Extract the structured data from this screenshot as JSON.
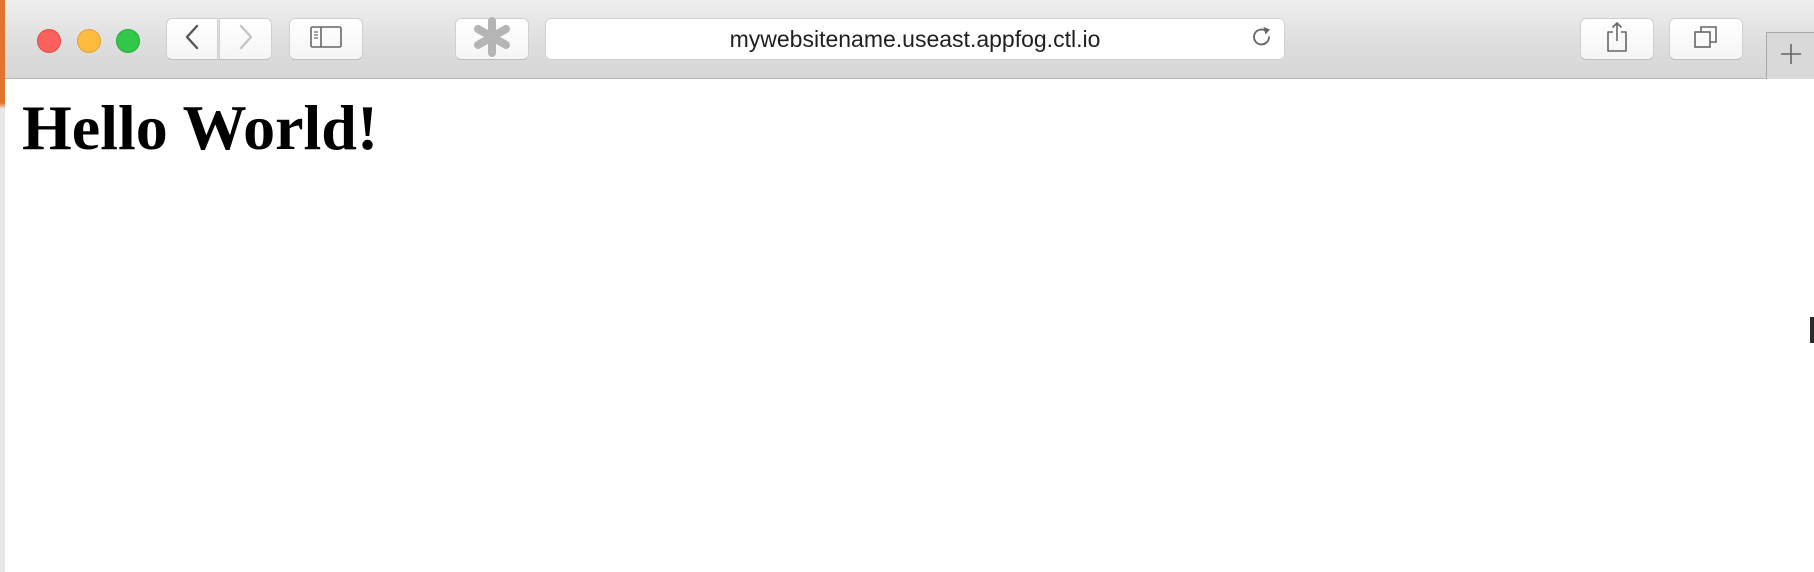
{
  "browser": {
    "address_url": "mywebsitename.useast.appfog.ctl.io",
    "icons": {
      "back": "chevron-left-icon",
      "forward": "chevron-right-icon",
      "sidebar": "sidebar-icon",
      "extension": "asterisk-icon",
      "reload": "reload-icon",
      "share": "share-icon",
      "tabs": "tabs-overview-icon",
      "new_tab": "plus-icon"
    },
    "traffic_lights": {
      "close_color": "#fc615d",
      "minimize_color": "#fdbc40",
      "maximize_color": "#34c84a"
    },
    "forward_enabled": false
  },
  "page": {
    "heading": "Hello World!"
  }
}
